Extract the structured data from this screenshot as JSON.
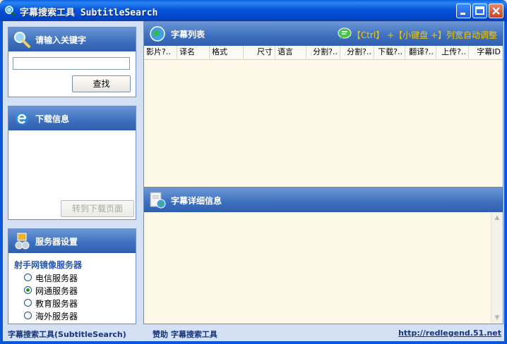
{
  "window": {
    "title": "字幕搜索工具 SubtitleSearch"
  },
  "search_panel": {
    "title": "请输入关键字",
    "input_value": "",
    "search_button": "查找"
  },
  "download_panel": {
    "title": "下载信息",
    "goto_button": "转到下载页面"
  },
  "server_panel": {
    "title": "服务器设置",
    "subtitle": "射手网镜像服务器",
    "options": [
      {
        "label": "电信服务器",
        "selected": false
      },
      {
        "label": "网通服务器",
        "selected": true
      },
      {
        "label": "教育服务器",
        "selected": false
      },
      {
        "label": "海外服务器",
        "selected": false
      }
    ]
  },
  "list_panel": {
    "title": "字幕列表",
    "hint": "【Ctrl】 +【小键盘 +】列宽自动调整",
    "columns": [
      "影片?..",
      "译名",
      "格式",
      "尺寸",
      "语言",
      "分割?..",
      "分割?..",
      "下载?..",
      "翻译?..",
      "上传?..",
      "字幕ID"
    ]
  },
  "detail_panel": {
    "title": "字幕详细信息"
  },
  "statusbar": {
    "app": "字幕搜索工具(SubtitleSearch)",
    "sponsor": "赞助 字幕搜索工具",
    "url": "http://redlegend.51.net"
  },
  "colors": {
    "titlebar": "#0A55D8",
    "panel_header": "#3D6FBE",
    "hint_text": "#F5C800",
    "list_bg": "#FDF8E8",
    "status_text": "#16357A"
  }
}
